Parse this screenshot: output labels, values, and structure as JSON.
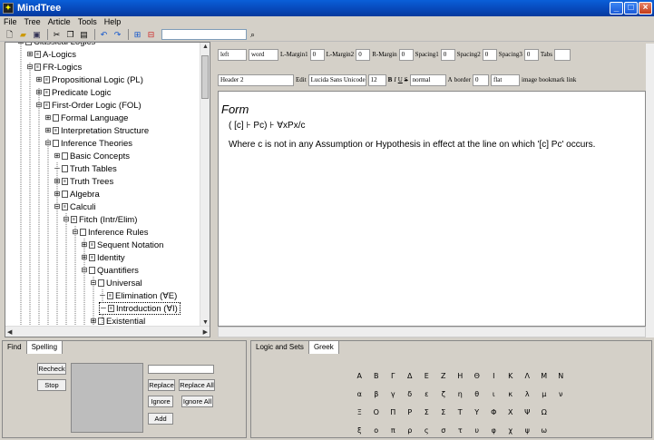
{
  "window": {
    "title": "MindTree",
    "min": "_",
    "max": "□",
    "close": "×"
  },
  "menu": [
    "File",
    "Tree",
    "Article",
    "Tools",
    "Help"
  ],
  "tree": {
    "nodes": [
      {
        "label": "Classical Logics",
        "depth": 1,
        "exp": "-",
        "icon": "B",
        "partial": true
      },
      {
        "label": "A-Logics",
        "depth": 2,
        "exp": "+",
        "icon": "B"
      },
      {
        "label": "FR-Logics",
        "depth": 2,
        "exp": "-",
        "icon": "B"
      },
      {
        "label": "Propositional Logic (PL)",
        "depth": 3,
        "exp": "+",
        "icon": "B"
      },
      {
        "label": "Predicate Logic",
        "depth": 3,
        "exp": "+",
        "icon": "B"
      },
      {
        "label": "First-Order Logic (FOL)",
        "depth": 3,
        "exp": "-",
        "icon": "B"
      },
      {
        "label": "Formal Language",
        "depth": 4,
        "exp": "+",
        "icon": ""
      },
      {
        "label": "Interpretation Structure",
        "depth": 4,
        "exp": "+",
        "icon": "B"
      },
      {
        "label": "Inference Theories",
        "depth": 4,
        "exp": "-",
        "icon": ""
      },
      {
        "label": "Basic Concepts",
        "depth": 5,
        "exp": "+",
        "icon": ""
      },
      {
        "label": "Truth Tables",
        "depth": 5,
        "exp": "",
        "icon": ""
      },
      {
        "label": "Truth Trees",
        "depth": 5,
        "exp": "+",
        "icon": "B"
      },
      {
        "label": "Algebra",
        "depth": 5,
        "exp": "+",
        "icon": ""
      },
      {
        "label": "Calculi",
        "depth": 5,
        "exp": "-",
        "icon": "B"
      },
      {
        "label": "Fitch (Intr/Elim)",
        "depth": 6,
        "exp": "-",
        "icon": "B"
      },
      {
        "label": "Inference Rules",
        "depth": 7,
        "exp": "-",
        "icon": ""
      },
      {
        "label": "Sequent Notation",
        "depth": 8,
        "exp": "+",
        "icon": "B"
      },
      {
        "label": "Identity",
        "depth": 8,
        "exp": "+",
        "icon": "B"
      },
      {
        "label": "Quantifiers",
        "depth": 8,
        "exp": "-",
        "icon": ""
      },
      {
        "label": "Universal",
        "depth": 9,
        "exp": "-",
        "icon": ""
      },
      {
        "label": "Elimination (∀E)",
        "depth": 10,
        "exp": "",
        "icon": "B"
      },
      {
        "label": "Introduction (∀I)",
        "depth": 10,
        "exp": "",
        "icon": "B",
        "selected": true
      },
      {
        "label": "Existential",
        "depth": 9,
        "exp": "+",
        "icon": ""
      }
    ]
  },
  "format1": {
    "align": "left",
    "wrap": "word",
    "l_margin1_label": "L-Margin1",
    "l_margin1": "0",
    "l_margin2_label": "L-Margin2",
    "l_margin2": "0",
    "r_margin_label": "R-Margin",
    "r_margin": "0",
    "spacing1_label": "Spacing1",
    "spacing1": "0",
    "spacing2_label": "Spacing2",
    "spacing2": "0",
    "spacing3_label": "Spacing3",
    "spacing3": "0",
    "tabs_label": "Tabs",
    "tabs": ""
  },
  "format2": {
    "style": "Header 2",
    "edit": "Edit",
    "font": "Lucida Sans Unicode",
    "size": "12",
    "bold": "B",
    "italic": "I",
    "underline": "U",
    "strike": "S",
    "weight": "normal",
    "a": "A",
    "border_label": "border",
    "border": "0",
    "relief": "flat",
    "image": "image",
    "bookmark": "bookmark",
    "link": "link"
  },
  "editor": {
    "heading": "Form",
    "line1": "( [c] ⊦ Pc) ⊦ ∀xPx/c",
    "line2": "Where c is not in any Assumption or Hypothesis in effect at the line on which '[c]  Pc' occurs."
  },
  "left_tabs": [
    "Find",
    "Spelling"
  ],
  "spell": {
    "recheck": "Recheck",
    "stop": "Stop",
    "replace": "Replace",
    "replace_all": "Replace All",
    "ignore": "Ignore",
    "ignore_all": "Ignore All",
    "add": "Add"
  },
  "right_tabs": [
    "Logic and Sets",
    "Greek"
  ],
  "greek_rows": [
    [
      "Α",
      "Β",
      "Γ",
      "Δ",
      "Ε",
      "Ζ",
      "Η",
      "Θ",
      "Ι",
      "Κ",
      "Λ",
      "Μ",
      "Ν"
    ],
    [
      "α",
      "β",
      "γ",
      "δ",
      "ε",
      "ζ",
      "η",
      "θ",
      "ι",
      "κ",
      "λ",
      "μ",
      "ν"
    ],
    [
      "Ξ",
      "Ο",
      "Π",
      "Ρ",
      "Σ",
      "Σ",
      "Τ",
      "Υ",
      "Φ",
      "Χ",
      "Ψ",
      "Ω"
    ],
    [
      "ξ",
      "ο",
      "π",
      "ρ",
      "ς",
      "σ",
      "τ",
      "υ",
      "φ",
      "χ",
      "ψ",
      "ω"
    ]
  ]
}
